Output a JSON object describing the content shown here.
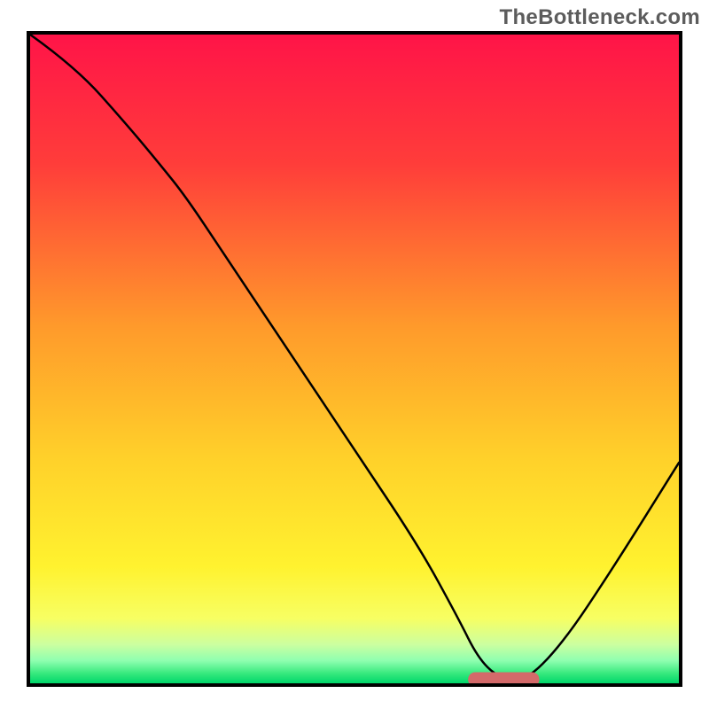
{
  "watermark": "TheBottleneck.com",
  "chart_data": {
    "type": "line",
    "title": "",
    "xlabel": "",
    "ylabel": "",
    "xlim": [
      0,
      100
    ],
    "ylim": [
      0,
      100
    ],
    "grid": false,
    "legend": false,
    "gradient_stops": [
      {
        "offset": 0,
        "color": "#ff1448"
      },
      {
        "offset": 0.2,
        "color": "#ff3d3a"
      },
      {
        "offset": 0.45,
        "color": "#ff9a2b"
      },
      {
        "offset": 0.65,
        "color": "#ffd02a"
      },
      {
        "offset": 0.82,
        "color": "#fff22f"
      },
      {
        "offset": 0.9,
        "color": "#f7ff63"
      },
      {
        "offset": 0.94,
        "color": "#ccffa0"
      },
      {
        "offset": 0.965,
        "color": "#8fffb0"
      },
      {
        "offset": 0.985,
        "color": "#36e97d"
      },
      {
        "offset": 1.0,
        "color": "#00d66a"
      }
    ],
    "series": [
      {
        "name": "bottleneck-curve",
        "x": [
          0,
          7,
          15,
          20,
          24,
          30,
          40,
          50,
          60,
          66,
          69,
          72,
          76,
          82,
          90,
          100
        ],
        "y": [
          100,
          95,
          86,
          80,
          75,
          66,
          51,
          36,
          21,
          10,
          4,
          1,
          0,
          6,
          18,
          34
        ]
      }
    ],
    "annotations": [
      {
        "name": "optimal-marker",
        "shape": "rounded-rect",
        "color": "#d46a6a",
        "x_center": 73,
        "y_center": 0.6,
        "width": 11,
        "height": 2.2
      }
    ]
  }
}
